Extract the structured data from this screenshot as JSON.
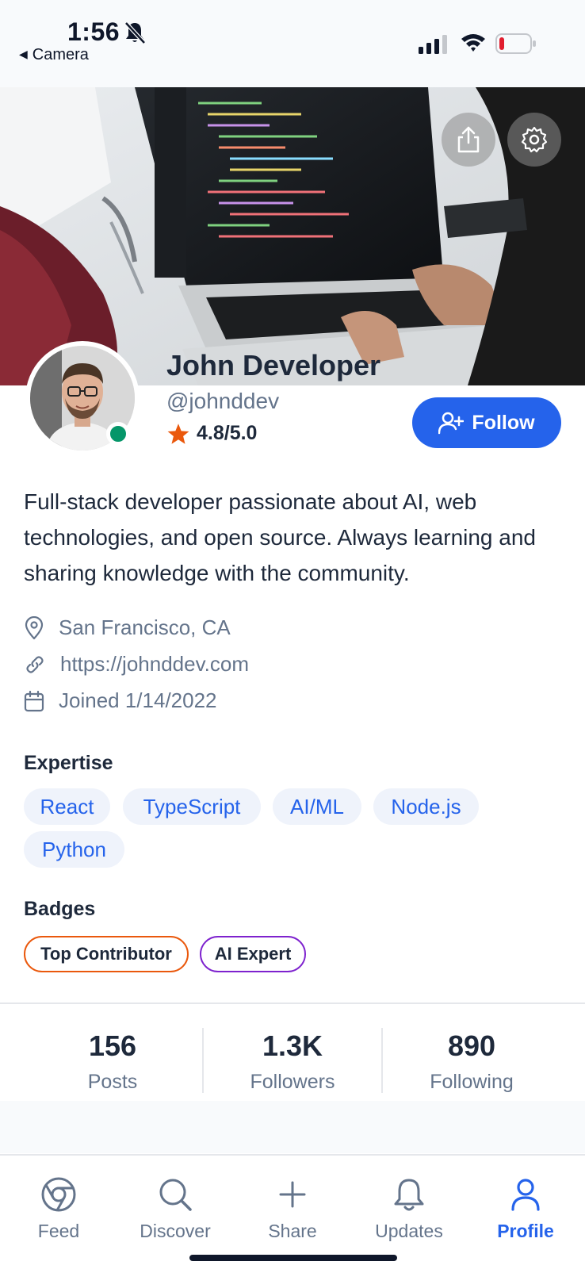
{
  "status_bar": {
    "time": "1:56",
    "back_label": "Camera"
  },
  "profile": {
    "name": "John Developer",
    "handle": "@johnddev",
    "rating": "4.8/5.0",
    "follow_label": "Follow",
    "bio": "Full-stack developer passionate about AI, web technologies, and open source. Always learning and sharing knowledge with the community.",
    "location": "San Francisco, CA",
    "website": "https://johnddev.com",
    "joined": "Joined 1/14/2022",
    "online_color": "#059669"
  },
  "expertise": {
    "title": "Expertise",
    "tags": [
      "React",
      "TypeScript",
      "AI/ML",
      "Node.js",
      "Python"
    ]
  },
  "badges": {
    "title": "Badges",
    "items": [
      {
        "label": "Top Contributor",
        "color": "#ea580c"
      },
      {
        "label": "AI Expert",
        "color": "#7e22ce"
      }
    ]
  },
  "stats": [
    {
      "value": "156",
      "label": "Posts"
    },
    {
      "value": "1.3K",
      "label": "Followers"
    },
    {
      "value": "890",
      "label": "Following"
    }
  ],
  "tabs": [
    {
      "label": "Feed",
      "icon": "chrome-icon"
    },
    {
      "label": "Discover",
      "icon": "search-icon"
    },
    {
      "label": "Share",
      "icon": "plus-icon"
    },
    {
      "label": "Updates",
      "icon": "bell-icon"
    },
    {
      "label": "Profile",
      "icon": "user-icon",
      "active": true
    }
  ],
  "colors": {
    "accent": "#2563eb",
    "star": "#ea580c",
    "text": "#1e293b",
    "muted": "#64748b"
  }
}
